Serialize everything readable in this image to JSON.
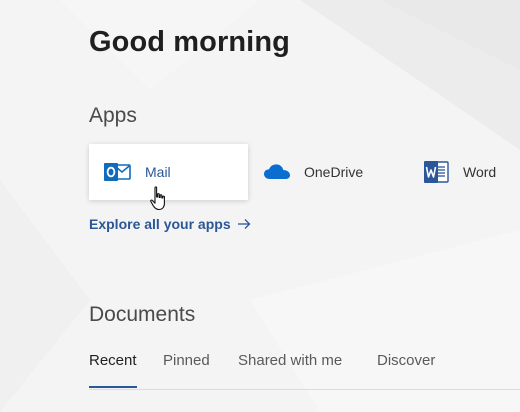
{
  "greeting": "Good morning",
  "apps": {
    "title": "Apps",
    "items": [
      {
        "label": "Mail",
        "icon": "outlook-icon",
        "hovered": true
      },
      {
        "label": "OneDrive",
        "icon": "onedrive-cloud-icon"
      },
      {
        "label": "Word",
        "icon": "word-icon"
      }
    ],
    "explore_link": "Explore all your apps"
  },
  "documents": {
    "title": "Documents",
    "tabs": [
      {
        "label": "Recent",
        "active": true
      },
      {
        "label": "Pinned"
      },
      {
        "label": "Shared with me"
      },
      {
        "label": "Discover"
      }
    ]
  },
  "colors": {
    "accent": "#2b5797",
    "outlook_blue": "#0f6cbd",
    "onedrive_blue": "#0a6ed1",
    "word_blue": "#2b579a",
    "background": "#f4f4f4"
  }
}
